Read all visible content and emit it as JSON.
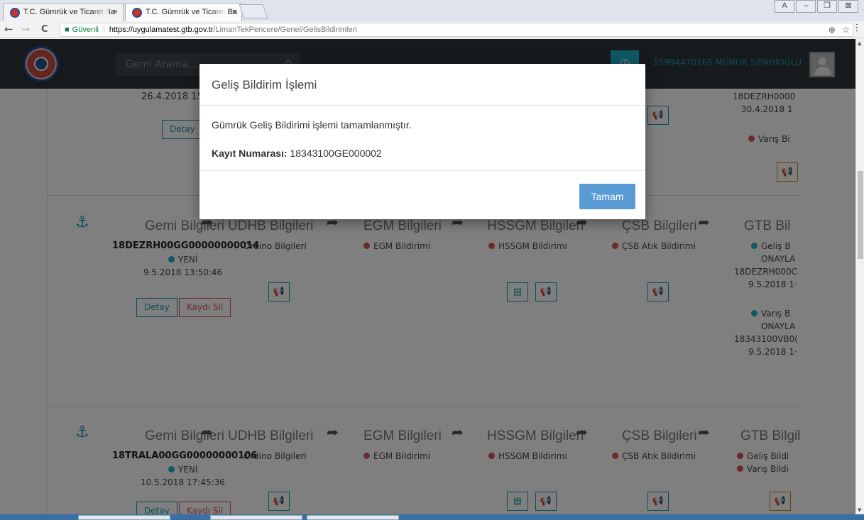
{
  "browser": {
    "tabs": [
      {
        "title": "T.C. Gümrük ve Ticaret Ba",
        "close": "×"
      },
      {
        "title": "T.C. Gümrük ve Ticaret Ba",
        "close": "×"
      }
    ],
    "window_buttons": {
      "profile": "A",
      "minimize": "–",
      "restore": "❐",
      "close": "⊠"
    },
    "nav": {
      "back": "←",
      "forward": "→",
      "reload": "C"
    },
    "address": {
      "secure_label": "Güvenli",
      "url_host": "https://uygulamatest.gtb.gov.tr",
      "url_path": "/LimanTekPencere/Genel/GelisBildirimleri",
      "zoom_icon": "⊕",
      "star_icon": "☆"
    },
    "menu": "⋮"
  },
  "appbar": {
    "search_placeholder": "Gemi Arama...",
    "user": "15994470166 MÜNUR SİPAHİOĞLU"
  },
  "content": {
    "top_partial": {
      "date": "26.4.2018 15:",
      "detay": "Detay",
      "gtb_reg": "18DEZRH0000",
      "gtb_date": "30.4.2018 1",
      "gtb_item": "Varış Bi"
    },
    "cards": [
      {
        "headers": {
          "gemi": "Gemi Bilgileri",
          "udhb": "UDHB Bilgileri",
          "egm": "EGM Bilgileri",
          "hssgm": "HSSGM Bilgileri",
          "csb": "ÇSB Bilgileri",
          "gtb": "GTB Bil"
        },
        "reg_no": "18DEZRH00GG00000000014",
        "status": "YENİ",
        "date": "9.5.2018 13:50:46",
        "detay": "Detay",
        "kaydi_sil": "Kaydı Sil",
        "udhb_item": "Ordino Bilgileri",
        "egm_item": "EGM Bildirimi",
        "hssgm_item": "HSSGM Bildirimi",
        "csb_item": "ÇSB Atık Bildirimi",
        "gtb_lines": [
          "Geliş B",
          "ONAYLA",
          "18DEZRH000C",
          "9.5.2018 1·",
          "Varış B",
          "ONAYLA",
          "18343100VB0(",
          "9.5.2018 1·"
        ]
      },
      {
        "headers": {
          "gemi": "Gemi Bilgileri",
          "udhb": "UDHB Bilgileri",
          "egm": "EGM Bilgileri",
          "hssgm": "HSSGM Bilgileri",
          "csb": "ÇSB Bilgileri",
          "gtb": "GTB Bilgil"
        },
        "reg_no": "18TRALA00GG00000000106",
        "status": "YENİ",
        "date": "10.5.2018 17:45:36",
        "detay": "Detay",
        "kaydi_sil": "Kaydı Sil",
        "udhb_item": "Ordino Bilgileri",
        "egm_item": "EGM Bildirimi",
        "hssgm_item": "HSSGM Bildirimi",
        "csb_item": "ÇSB Atık Bildirimi",
        "gtb_lines": [
          "Geliş Bildi",
          "Varış Bildi"
        ]
      }
    ]
  },
  "modal": {
    "title": "Geliş Bildirim İşlemi",
    "message": "Gümrük Geliş Bildirimi işlemi tamamlanmıştır.",
    "reg_label": "Kayıt Numarası:",
    "reg_value": "18343100GE000002",
    "ok_button": "Tamam"
  },
  "icons": {
    "anchor": "anchor-icon",
    "share": "share-icon",
    "megaphone": "megaphone-icon",
    "book": "book-icon",
    "clock": "clock-icon"
  }
}
